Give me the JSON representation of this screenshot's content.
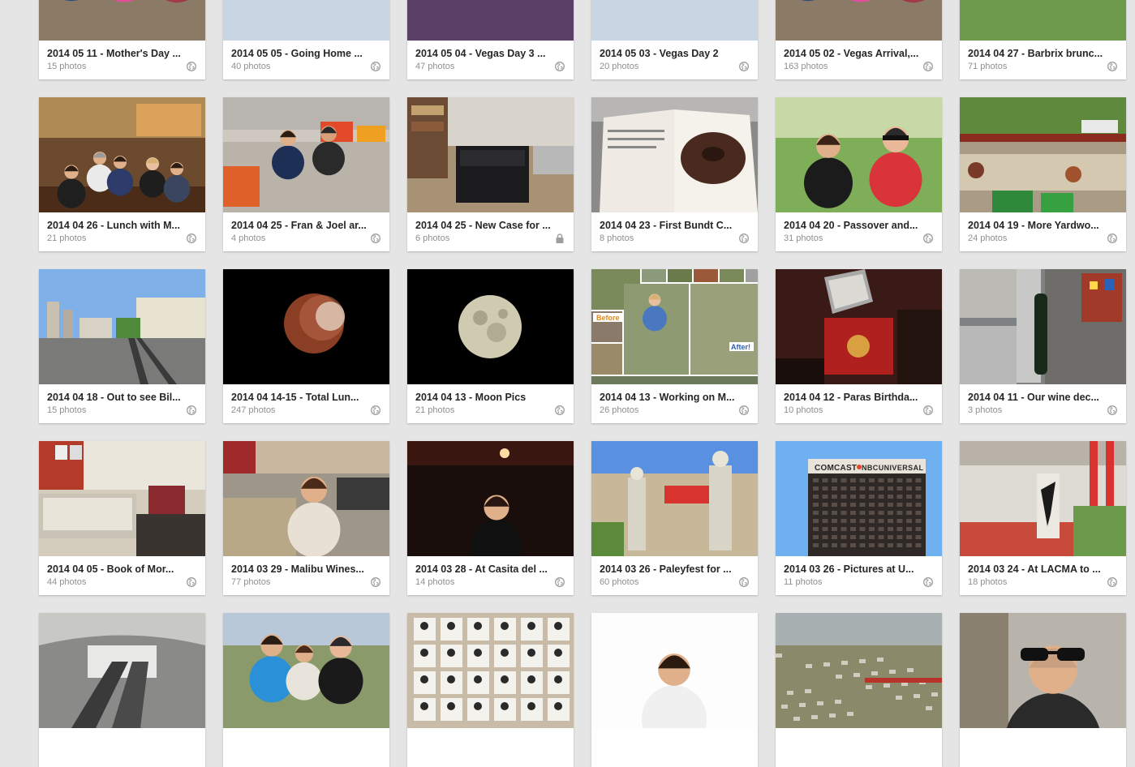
{
  "albums": [
    {
      "title": "2014 05 11 - Mother's Day ...",
      "count": "15 photos",
      "visibility": "public-globe-icon",
      "scene": "people"
    },
    {
      "title": "2014 05 05 - Going Home ...",
      "count": "40 photos",
      "visibility": "public-globe-icon",
      "scene": "city"
    },
    {
      "title": "2014 05 04 - Vegas Day 3 ...",
      "count": "47 photos",
      "visibility": "public-globe-icon",
      "scene": "vegas"
    },
    {
      "title": "2014 05 03 - Vegas Day 2",
      "count": "20 photos",
      "visibility": "public-globe-icon",
      "scene": "city"
    },
    {
      "title": "2014 05 02 - Vegas Arrival,...",
      "count": "163 photos",
      "visibility": "public-globe-icon",
      "scene": "people"
    },
    {
      "title": "2014 04 27 - Barbrix brunc...",
      "count": "71 photos",
      "visibility": "public-globe-icon",
      "scene": "garden"
    },
    {
      "title": "2014 04 26 - Lunch with M...",
      "count": "21 photos",
      "visibility": "public-globe-icon",
      "scene": "restaurant"
    },
    {
      "title": "2014 04 25 - Fran & Joel ar...",
      "count": "4 photos",
      "visibility": "public-globe-icon",
      "scene": "couch"
    },
    {
      "title": "2014 04 25 - New Case for ...",
      "count": "6 photos",
      "visibility": "private-lock-icon",
      "scene": "office"
    },
    {
      "title": "2014 04 23 - First Bundt C...",
      "count": "8 photos",
      "visibility": "public-globe-icon",
      "scene": "book"
    },
    {
      "title": "2014 04 20 - Passover and...",
      "count": "31 photos",
      "visibility": "public-globe-icon",
      "scene": "couple"
    },
    {
      "title": "2014 04 19 - More Yardwo...",
      "count": "24 photos",
      "visibility": "public-globe-icon",
      "scene": "patio"
    },
    {
      "title": "2014 04 18 - Out to see Bil...",
      "count": "15 photos",
      "visibility": "public-globe-icon",
      "scene": "street"
    },
    {
      "title": "2014 04 14-15 - Total Lun...",
      "count": "247 photos",
      "visibility": "public-globe-icon",
      "scene": "redmoon"
    },
    {
      "title": "2014 04 13 - Moon Pics",
      "count": "21 photos",
      "visibility": "public-globe-icon",
      "scene": "moon"
    },
    {
      "title": "2014 04 13 - Working on M...",
      "count": "26 photos",
      "visibility": "public-globe-icon",
      "scene": "collage",
      "labels": [
        "Before",
        "After!"
      ]
    },
    {
      "title": "2014 04 12 - Paras Birthda...",
      "count": "10 photos",
      "visibility": "public-globe-icon",
      "scene": "bar"
    },
    {
      "title": "2014 04 11 - Our wine dec...",
      "count": "3 photos",
      "visibility": "public-globe-icon",
      "scene": "kitchen"
    },
    {
      "title": "2014 04 05 - Book of Mor...",
      "count": "44 photos",
      "visibility": "public-globe-icon",
      "scene": "dining"
    },
    {
      "title": "2014 03 29 - Malibu Wines...",
      "count": "77 photos",
      "visibility": "public-globe-icon",
      "scene": "woman"
    },
    {
      "title": "2014 03 28 - At Casita del ...",
      "count": "14 photos",
      "visibility": "public-globe-icon",
      "scene": "darkwoman"
    },
    {
      "title": "2014 03 26 - Paleyfest for ...",
      "count": "60 photos",
      "visibility": "public-globe-icon",
      "scene": "mall"
    },
    {
      "title": "2014 03 26 - Pictures at U...",
      "count": "11 photos",
      "visibility": "public-globe-icon",
      "scene": "tower",
      "labels": [
        "COMCAST",
        "NBCUNIVERSAL"
      ]
    },
    {
      "title": "2014 03 24 - At LACMA to ...",
      "count": "18 photos",
      "visibility": "public-globe-icon",
      "scene": "lacma"
    },
    {
      "title": "",
      "count": "",
      "visibility": "",
      "scene": "escalator"
    },
    {
      "title": "",
      "count": "",
      "visibility": "",
      "scene": "trio"
    },
    {
      "title": "",
      "count": "",
      "visibility": "",
      "scene": "photowall"
    },
    {
      "title": "",
      "count": "",
      "visibility": "",
      "scene": "portrait"
    },
    {
      "title": "",
      "count": "",
      "visibility": "",
      "scene": "hills"
    },
    {
      "title": "",
      "count": "",
      "visibility": "",
      "scene": "sunglasses"
    }
  ],
  "colors": {
    "page_background": "#e5e5e5",
    "card_background": "#ffffff",
    "title_text": "#262626",
    "count_text": "#8f8f8f",
    "icon": "#9e9e9e"
  }
}
